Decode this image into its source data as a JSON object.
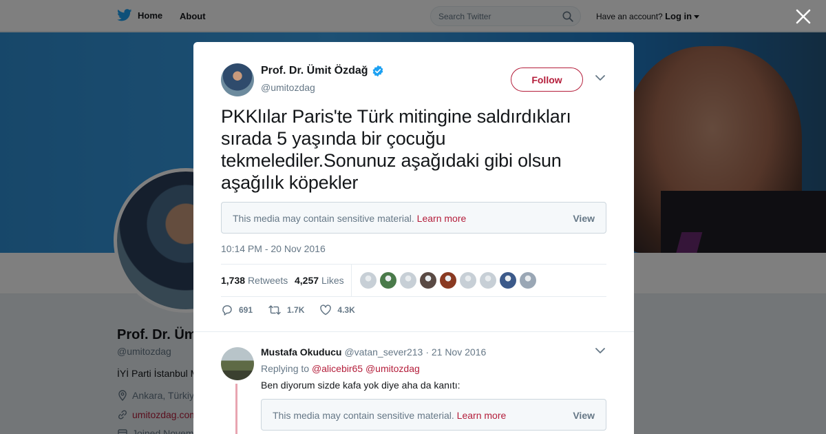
{
  "nav": {
    "home": "Home",
    "about": "About",
    "search_placeholder": "Search Twitter",
    "account_text": "Have an account?",
    "login": "Log in"
  },
  "profile": {
    "name": "Prof. Dr. Ümit Özdağ",
    "name_visible": "Prof. Dr. Üm",
    "handle": "@umitozdag",
    "bio": "İYİ Parti İstanbul M",
    "location": "Ankara, Türkiy",
    "url": "umitozdag.com",
    "joined": "Joined Novem"
  },
  "tweet": {
    "author": "Prof. Dr. Ümit Özdağ",
    "handle": "@umitozdag",
    "follow_label": "Follow",
    "text": "PKKlılar Paris'te Türk mitingine saldırdıkları sırada 5 yaşında bir çocuğu tekmelediler.Sonunuz aşağıdaki gibi olsun aşağılık köpekler",
    "sensitive_msg": "This media may contain sensitive material.",
    "learn_more": "Learn more",
    "view": "View",
    "time": "10:14 PM - 20 Nov 2016",
    "retweets_count": "1,738",
    "retweets_label": "Retweets",
    "likes_count": "4,257",
    "likes_label": "Likes",
    "reply_count": "691",
    "retweet_count_short": "1.7K",
    "like_count_short": "4.3K"
  },
  "facepile_colors": [
    "#c7cfd6",
    "#4a7a4a",
    "#c7cfd6",
    "#5a4a44",
    "#8a3a22",
    "#c7cfd6",
    "#c7cfd6",
    "#3c5a8a",
    "#9aa7b5"
  ],
  "reply": {
    "author": "Mustafa Okuducu",
    "handle": "@vatan_sever213",
    "date": "· 21 Nov 2016",
    "replying_to": "Replying to",
    "mention_1": "@alicebir65",
    "mention_2": "@umitozdag",
    "text": "Ben diyorum sizde kafa yok diye aha da kanıtı:"
  },
  "colors": {
    "accent": "#b41d3a",
    "twitter_blue": "#1da1f2",
    "muted": "#657786"
  }
}
